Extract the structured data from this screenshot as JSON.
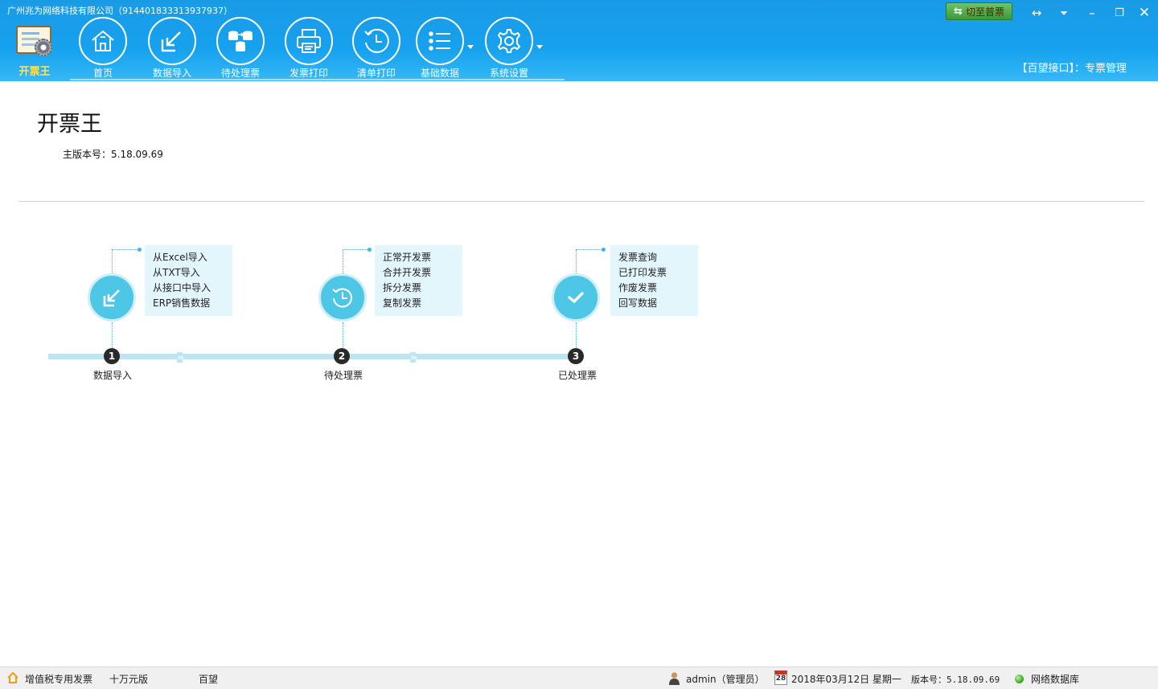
{
  "titlebar": {
    "company": "广州兆为网络科技有限公司（914401833313937937）",
    "app_name": "开票王",
    "switch_button": "切至普票",
    "module": "【百望接口】：专票管理"
  },
  "nav": [
    {
      "label": "首页",
      "icon": "home-icon"
    },
    {
      "label": "数据导入",
      "icon": "import-icon"
    },
    {
      "label": "待处理票",
      "icon": "pending-icon"
    },
    {
      "label": "发票打印",
      "icon": "printer-icon"
    },
    {
      "label": "清单打印",
      "icon": "clock-icon"
    },
    {
      "label": "基础数据",
      "icon": "list-icon"
    },
    {
      "label": "系统设置",
      "icon": "gear-icon"
    }
  ],
  "main": {
    "title": "开票王",
    "version_label": "主版本号：",
    "version": "5.18.09.69"
  },
  "workflow": {
    "steps": [
      {
        "number": "1",
        "label": "数据导入",
        "items": [
          "从Excel导入",
          "从TXT导入",
          "从接口中导入",
          "ERP销售数据"
        ]
      },
      {
        "number": "2",
        "label": "待处理票",
        "items": [
          "正常开发票",
          "合并开发票",
          "拆分发票",
          "复制发票"
        ]
      },
      {
        "number": "3",
        "label": "已处理票",
        "items": [
          "发票查询",
          "已打印发票",
          "作废发票",
          "回写数据"
        ]
      }
    ]
  },
  "statusbar": {
    "invoice_type": "增值税专用发票",
    "edition": "十万元版",
    "provider": "百望",
    "user": "admin（管理员）",
    "calendar_day": "28",
    "date": "2018年03月12日 星期一",
    "version": "版本号：5.18.09.69",
    "database": "网络数据库"
  },
  "colors": {
    "ribbon": "#16a1ee",
    "step_circle": "#4ec6e6",
    "step_box": "#e3f6fc"
  }
}
